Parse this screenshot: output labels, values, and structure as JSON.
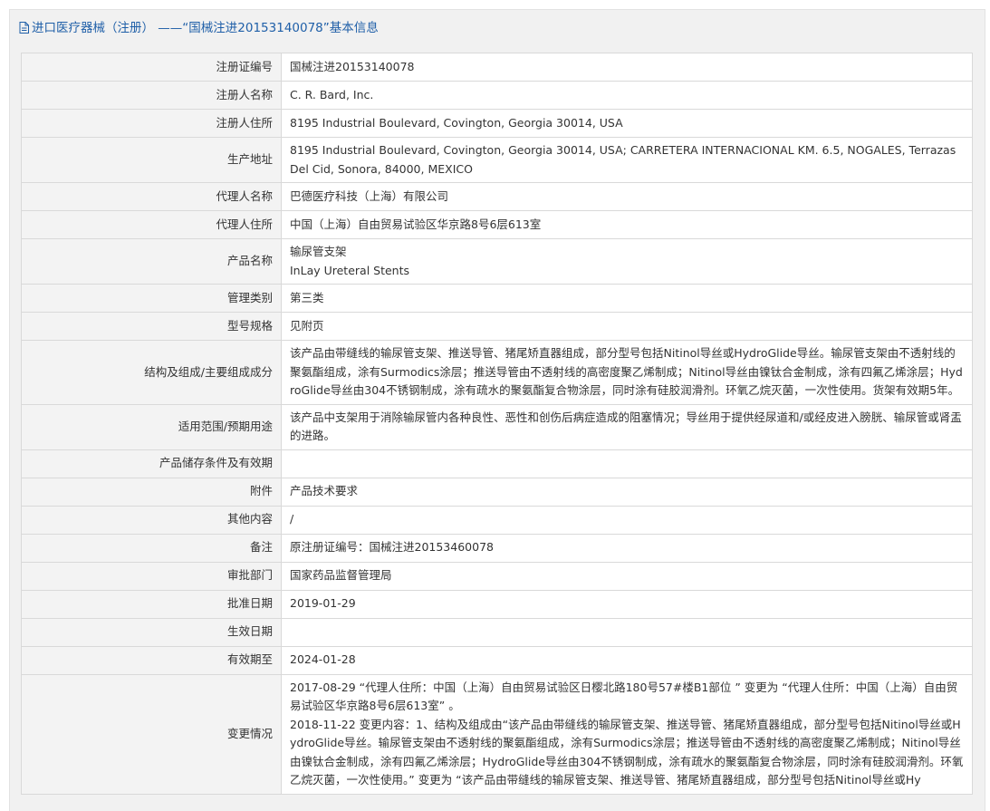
{
  "page": {
    "title": "进口医疗器械（注册） ——“国械注进20153140078”基本信息"
  },
  "rows": [
    {
      "label": "注册证编号",
      "lines": [
        "国械注进20153140078"
      ]
    },
    {
      "label": "注册人名称",
      "lines": [
        "C. R. Bard, Inc."
      ]
    },
    {
      "label": "注册人住所",
      "lines": [
        "8195 Industrial Boulevard, Covington, Georgia 30014, USA"
      ]
    },
    {
      "label": "生产地址",
      "lines": [
        "8195 Industrial Boulevard, Covington, Georgia 30014, USA; CARRETERA INTERNACIONAL KM. 6.5, NOGALES, Terrazas Del Cid, Sonora, 84000, MEXICO"
      ]
    },
    {
      "label": "代理人名称",
      "lines": [
        "巴德医疗科技（上海）有限公司"
      ]
    },
    {
      "label": "代理人住所",
      "lines": [
        "中国（上海）自由贸易试验区华京路8号6层613室"
      ]
    },
    {
      "label": "产品名称",
      "lines": [
        "输尿管支架",
        "InLay Ureteral Stents"
      ]
    },
    {
      "label": "管理类别",
      "lines": [
        "第三类"
      ]
    },
    {
      "label": "型号规格",
      "lines": [
        "见附页"
      ]
    },
    {
      "label": "结构及组成/主要组成成分",
      "lines": [
        "该产品由带缝线的输尿管支架、推送导管、猪尾矫直器组成，部分型号包括Nitinol导丝或HydroGlide导丝。输尿管支架由不透射线的聚氨酯组成，涂有Surmodics涂层；推送导管由不透射线的高密度聚乙烯制成；Nitinol导丝由镍钛合金制成，涂有四氟乙烯涂层；HydroGlide导丝由304不锈钢制成，涂有疏水的聚氨酯复合物涂层，同时涂有硅胶润滑剂。环氧乙烷灭菌，一次性使用。货架有效期5年。"
      ]
    },
    {
      "label": "适用范围/预期用途",
      "lines": [
        "该产品中支架用于消除输尿管内各种良性、恶性和创伤后病症造成的阻塞情况；导丝用于提供经尿道和/或经皮进入膀胱、输尿管或肾盂的进路。"
      ]
    },
    {
      "label": "产品储存条件及有效期",
      "lines": [
        ""
      ]
    },
    {
      "label": "附件",
      "lines": [
        "产品技术要求"
      ]
    },
    {
      "label": "其他内容",
      "lines": [
        "/"
      ]
    },
    {
      "label": "备注",
      "lines": [
        "原注册证编号：国械注进20153460078"
      ]
    },
    {
      "label": "审批部门",
      "lines": [
        "国家药品监督管理局"
      ]
    },
    {
      "label": "批准日期",
      "lines": [
        "2019-01-29"
      ]
    },
    {
      "label": "生效日期",
      "lines": [
        ""
      ]
    },
    {
      "label": "有效期至",
      "lines": [
        "2024-01-28"
      ]
    },
    {
      "label": "变更情况",
      "lines": [
        "2017-08-29 “代理人住所：中国（上海）自由贸易试验区日樱北路180号57#楼B1部位 ” 变更为 “代理人住所：中国（上海）自由贸易试验区华京路8号6层613室” 。",
        "2018-11-22 变更内容：1、结构及组成由“该产品由带缝线的输尿管支架、推送导管、猪尾矫直器组成，部分型号包括Nitinol导丝或HydroGlide导丝。输尿管支架由不透射线的聚氨酯组成，涂有Surmodics涂层；推送导管由不透射线的高密度聚乙烯制成；Nitinol导丝由镍钛合金制成，涂有四氟乙烯涂层；HydroGlide导丝由304不锈钢制成，涂有疏水的聚氨酯复合物涂层，同时涂有硅胶润滑剂。环氧乙烷灭菌，一次性使用。” 变更为 “该产品由带缝线的输尿管支架、推送导管、猪尾矫直器组成，部分型号包括Nitinol导丝或Hy"
      ]
    }
  ]
}
